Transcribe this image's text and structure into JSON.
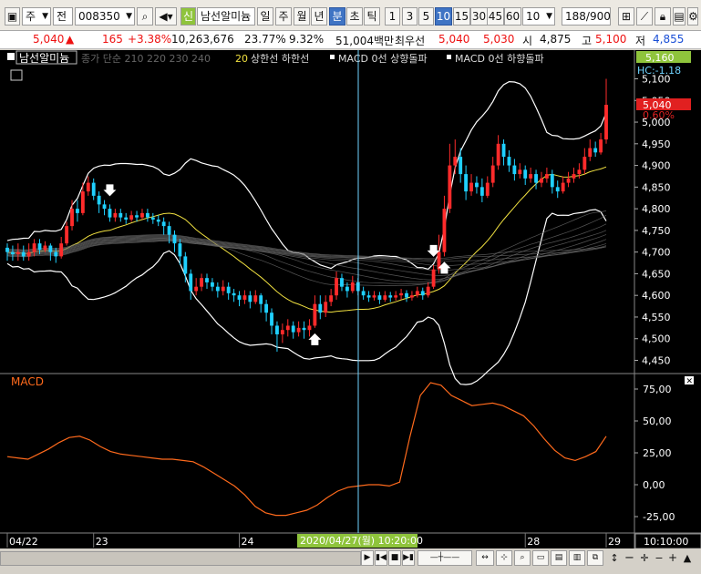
{
  "toolbar": {
    "market_select": "주",
    "type_select": "전",
    "stock_code": "008350",
    "stock_name": "남선알미늄",
    "period_buttons": [
      "일",
      "주",
      "월",
      "년",
      "분",
      "초",
      "틱"
    ],
    "active_period": "분",
    "interval_buttons": [
      "1",
      "3",
      "5",
      "10",
      "15",
      "30",
      "45",
      "60"
    ],
    "active_interval": "10",
    "interval_select": "10",
    "count_value": "188",
    "count_total": "/900"
  },
  "quote": {
    "price": "5,040",
    "change_arrow": "▲",
    "change": "165",
    "change_pct": "+3.38%",
    "volume": "10,263,676",
    "vol_ratio": "23.77%",
    "turnover": "9.32%",
    "trade_value": "51,004백만",
    "stat_label": "최우선",
    "best_ask": "5,040",
    "best_bid": "5,030",
    "open_label": "시",
    "open": "4,875",
    "high_label": "고",
    "high": "5,100",
    "low_label": "저",
    "low": "4,855"
  },
  "chart_title": "남선알미늄",
  "legend": {
    "ma": "종가 단순 210 220 230 240",
    "envelope_period": "20",
    "envelope": "상한선 하한선",
    "macd_up": "MACD 0선 상향돌파",
    "macd_down": "MACD 0선 하향돌파"
  },
  "price_panel": {
    "current_price_label": "5,040",
    "current_pct_label": "0.60%",
    "high_label": "5,160",
    "hc_label": "HC:-1.18",
    "ticks": [
      "5,100",
      "5,050",
      "5,000",
      "4,950",
      "4,900",
      "4,850",
      "4,800",
      "4,750",
      "4,700",
      "4,650",
      "4,600",
      "4,550",
      "4,500",
      "4,450"
    ]
  },
  "macd_panel": {
    "label": "MACD",
    "ticks": [
      "75,00",
      "50,00",
      "25,00",
      "0,00",
      "-25,00"
    ]
  },
  "x_axis": {
    "labels": [
      "04/22",
      "23",
      "24",
      "28",
      "29"
    ],
    "crosshair_label": "2020/04/27(월) 10:20:00",
    "time_label": "10:10:00"
  },
  "colors": {
    "up": "#ff2b2b",
    "down": "#1fd0ff",
    "macd": "#ff6a1c",
    "ma": "#f0e040",
    "crosshair": "#6fd4ff",
    "active_button": "#3f74c4"
  },
  "chart_data": {
    "type": "candlestick",
    "title": "남선알미늄",
    "ylim": [
      4430,
      5120
    ],
    "x_labels": [
      "04/22",
      "23",
      "24",
      "28",
      "29"
    ],
    "candles": [
      [
        4710,
        4700,
        4680,
        4720
      ],
      [
        4700,
        4695,
        4680,
        4715
      ],
      [
        4695,
        4700,
        4680,
        4720
      ],
      [
        4700,
        4690,
        4680,
        4715
      ],
      [
        4690,
        4700,
        4680,
        4720
      ],
      [
        4700,
        4720,
        4690,
        4730
      ],
      [
        4720,
        4705,
        4695,
        4730
      ],
      [
        4705,
        4715,
        4700,
        4725
      ],
      [
        4715,
        4700,
        4680,
        4720
      ],
      [
        4700,
        4690,
        4675,
        4710
      ],
      [
        4690,
        4720,
        4685,
        4735
      ],
      [
        4720,
        4760,
        4715,
        4770
      ],
      [
        4760,
        4800,
        4750,
        4820
      ],
      [
        4800,
        4790,
        4770,
        4820
      ],
      [
        4790,
        4840,
        4785,
        4860
      ],
      [
        4840,
        4860,
        4830,
        4875
      ],
      [
        4860,
        4830,
        4820,
        4870
      ],
      [
        4830,
        4810,
        4790,
        4840
      ],
      [
        4810,
        4800,
        4785,
        4820
      ],
      [
        4800,
        4780,
        4770,
        4810
      ],
      [
        4780,
        4790,
        4770,
        4800
      ],
      [
        4790,
        4780,
        4770,
        4800
      ],
      [
        4780,
        4775,
        4765,
        4790
      ],
      [
        4775,
        4785,
        4770,
        4795
      ],
      [
        4785,
        4780,
        4770,
        4795
      ],
      [
        4780,
        4790,
        4775,
        4800
      ],
      [
        4790,
        4780,
        4770,
        4800
      ],
      [
        4780,
        4775,
        4765,
        4790
      ],
      [
        4775,
        4770,
        4760,
        4785
      ],
      [
        4770,
        4760,
        4740,
        4780
      ],
      [
        4760,
        4740,
        4720,
        4770
      ],
      [
        4740,
        4720,
        4700,
        4750
      ],
      [
        4720,
        4690,
        4670,
        4730
      ],
      [
        4690,
        4650,
        4630,
        4700
      ],
      [
        4650,
        4610,
        4590,
        4660
      ],
      [
        4610,
        4620,
        4600,
        4640
      ],
      [
        4620,
        4640,
        4610,
        4650
      ],
      [
        4640,
        4630,
        4615,
        4650
      ],
      [
        4630,
        4620,
        4610,
        4640
      ],
      [
        4620,
        4610,
        4595,
        4630
      ],
      [
        4610,
        4620,
        4600,
        4635
      ],
      [
        4620,
        4605,
        4590,
        4630
      ],
      [
        4605,
        4600,
        4585,
        4615
      ],
      [
        4600,
        4590,
        4575,
        4610
      ],
      [
        4590,
        4600,
        4580,
        4612
      ],
      [
        4600,
        4585,
        4570,
        4610
      ],
      [
        4585,
        4600,
        4580,
        4612
      ],
      [
        4600,
        4580,
        4560,
        4605
      ],
      [
        4580,
        4560,
        4540,
        4590
      ],
      [
        4560,
        4530,
        4510,
        4570
      ],
      [
        4530,
        4510,
        4470,
        4540
      ],
      [
        4510,
        4520,
        4490,
        4535
      ],
      [
        4520,
        4530,
        4505,
        4545
      ],
      [
        4530,
        4515,
        4500,
        4540
      ],
      [
        4515,
        4525,
        4505,
        4540
      ],
      [
        4525,
        4520,
        4500,
        4540
      ],
      [
        4520,
        4530,
        4505,
        4545
      ],
      [
        4530,
        4580,
        4525,
        4600
      ],
      [
        4580,
        4560,
        4545,
        4600
      ],
      [
        4560,
        4585,
        4550,
        4600
      ],
      [
        4585,
        4600,
        4575,
        4615
      ],
      [
        4600,
        4640,
        4590,
        4655
      ],
      [
        4640,
        4620,
        4610,
        4650
      ],
      [
        4620,
        4610,
        4595,
        4630
      ],
      [
        4610,
        4630,
        4605,
        4645
      ],
      [
        4630,
        4610,
        4600,
        4640
      ],
      [
        4610,
        4600,
        4590,
        4620
      ],
      [
        4600,
        4595,
        4585,
        4610
      ],
      [
        4595,
        4600,
        4588,
        4610
      ],
      [
        4600,
        4590,
        4580,
        4608
      ],
      [
        4590,
        4600,
        4585,
        4610
      ],
      [
        4600,
        4595,
        4585,
        4608
      ],
      [
        4595,
        4600,
        4588,
        4610
      ],
      [
        4600,
        4605,
        4590,
        4615
      ],
      [
        4605,
        4595,
        4585,
        4612
      ],
      [
        4595,
        4600,
        4588,
        4610
      ],
      [
        4600,
        4610,
        4595,
        4620
      ],
      [
        4610,
        4600,
        4590,
        4618
      ],
      [
        4600,
        4620,
        4595,
        4630
      ],
      [
        4620,
        4660,
        4615,
        4670
      ],
      [
        4660,
        4700,
        4650,
        4740
      ],
      [
        4700,
        4800,
        4690,
        4830
      ],
      [
        4800,
        4900,
        4790,
        4950
      ],
      [
        4900,
        4920,
        4880,
        4960
      ],
      [
        4920,
        4880,
        4860,
        4940
      ],
      [
        4880,
        4840,
        4820,
        4900
      ],
      [
        4840,
        4860,
        4830,
        4880
      ],
      [
        4860,
        4850,
        4835,
        4875
      ],
      [
        4850,
        4830,
        4815,
        4870
      ],
      [
        4830,
        4860,
        4825,
        4875
      ],
      [
        4860,
        4900,
        4850,
        4920
      ],
      [
        4900,
        4950,
        4890,
        4970
      ],
      [
        4950,
        4920,
        4900,
        4960
      ],
      [
        4920,
        4900,
        4885,
        4935
      ],
      [
        4900,
        4880,
        4865,
        4915
      ],
      [
        4880,
        4890,
        4870,
        4905
      ],
      [
        4890,
        4870,
        4855,
        4900
      ],
      [
        4870,
        4880,
        4860,
        4895
      ],
      [
        4880,
        4860,
        4845,
        4890
      ],
      [
        4860,
        4870,
        4850,
        4885
      ],
      [
        4870,
        4880,
        4860,
        4895
      ],
      [
        4880,
        4850,
        4835,
        4890
      ],
      [
        4850,
        4840,
        4825,
        4865
      ],
      [
        4840,
        4860,
        4835,
        4875
      ],
      [
        4860,
        4870,
        4850,
        4885
      ],
      [
        4870,
        4880,
        4860,
        4895
      ],
      [
        4880,
        4890,
        4870,
        4905
      ],
      [
        4890,
        4920,
        4880,
        4940
      ],
      [
        4920,
        4940,
        4910,
        4960
      ],
      [
        4940,
        4930,
        4920,
        4955
      ],
      [
        4930,
        4960,
        4925,
        4975
      ],
      [
        4960,
        5040,
        4950,
        5100
      ]
    ],
    "macd": [
      22,
      21,
      20,
      24,
      28,
      33,
      37,
      38,
      35,
      30,
      26,
      24,
      23,
      22,
      21,
      20,
      20,
      19,
      18,
      14,
      9,
      4,
      -1,
      -8,
      -17,
      -22,
      -24,
      -24,
      -22,
      -20,
      -16,
      -10,
      -5,
      -2,
      -1,
      0,
      0,
      -1,
      2,
      38,
      70,
      80,
      78,
      70,
      66,
      62,
      63,
      64,
      62,
      58,
      54,
      46,
      36,
      27,
      21,
      19,
      22,
      26,
      38
    ],
    "macd_ylim": [
      -35,
      85
    ],
    "markers": [
      {
        "type": "down",
        "index": 19
      },
      {
        "type": "up",
        "index": 57
      },
      {
        "type": "down",
        "index": 79
      },
      {
        "type": "up",
        "index": 81
      }
    ]
  }
}
